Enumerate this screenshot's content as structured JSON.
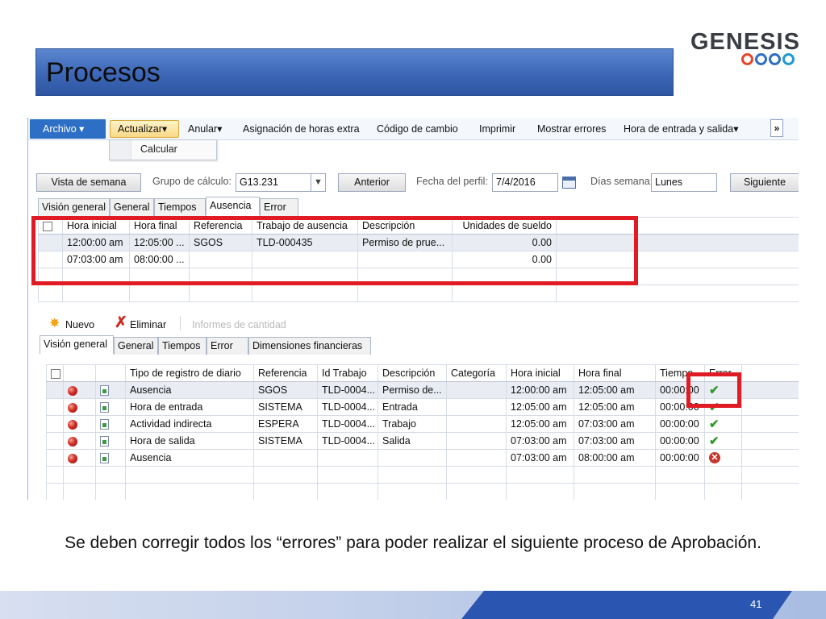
{
  "slide": {
    "title": "Procesos",
    "logo_text": "GENESIS",
    "caption": "Se deben corregir todos los “errores” para poder realizar el siguiente proceso de Aprobación.",
    "page_number": "41"
  },
  "ribbon": {
    "archivo": "Archivo ▾",
    "actualizar": "Actualizar▾",
    "anular": "Anular▾",
    "asignacion": "Asignación de horas extra",
    "codigo": "Código de cambio",
    "imprimir": "Imprimir",
    "mostrar": "Mostrar errores",
    "hora_entrada": "Hora de entrada y salida▾",
    "more": "»"
  },
  "menu": {
    "calcular": "Calcular"
  },
  "filters": {
    "vista_semana": "Vista de semana",
    "grupo_label": "Grupo de cálculo:",
    "grupo_value": "G13.231",
    "anterior": "Anterior",
    "fecha_label": "Fecha del perfil:",
    "fecha_value": "7/4/2016",
    "dias_label": "Días semana:",
    "dias_value": "Lunes",
    "siguiente": "Siguiente"
  },
  "upper_tabs": [
    "Visión general",
    "General",
    "Tiempos",
    "Ausencia",
    "Error"
  ],
  "upper_grid": {
    "headers": [
      "Hora inicial",
      "Hora final",
      "Referencia",
      "Trabajo de ausencia",
      "Descripción",
      "Unidades de sueldo"
    ],
    "rows": [
      [
        "12:00:00 am",
        "12:05:00 ...",
        "SGOS",
        "TLD-000435",
        "Permiso de prue...",
        "0.00"
      ],
      [
        "07:03:00 am",
        "08:00:00 ...",
        "",
        "",
        "",
        "0.00"
      ]
    ]
  },
  "toolbar2": {
    "nuevo": "Nuevo",
    "eliminar": "Eliminar",
    "informes": "Informes de cantidad"
  },
  "lower_tabs": [
    "Visión general",
    "General",
    "Tiempos",
    "Error",
    "Dimensiones financieras"
  ],
  "lower_grid": {
    "headers": [
      "Tipo de registro de diario",
      "Referencia",
      "Id Trabajo",
      "Descripción",
      "Categoría",
      "Hora inicial",
      "Hora final",
      "Tiempo",
      "Error"
    ],
    "rows": [
      {
        "tipo": "Ausencia",
        "ref": "SGOS",
        "id": "TLD-0004...",
        "desc": "Permiso de...",
        "cat": "",
        "ini": "12:00:00 am",
        "fin": "12:05:00 am",
        "tiempo": "00:00:00",
        "error": "ok"
      },
      {
        "tipo": "Hora de entrada",
        "ref": "SISTEMA",
        "id": "TLD-0004...",
        "desc": "Entrada",
        "cat": "",
        "ini": "12:05:00 am",
        "fin": "12:05:00 am",
        "tiempo": "00:00:00",
        "error": "ok"
      },
      {
        "tipo": "Actividad indirecta",
        "ref": "ESPERA",
        "id": "TLD-0004...",
        "desc": "Trabajo",
        "cat": "",
        "ini": "12:05:00 am",
        "fin": "07:03:00 am",
        "tiempo": "00:00:00",
        "error": "ok"
      },
      {
        "tipo": "Hora de salida",
        "ref": "SISTEMA",
        "id": "TLD-0004...",
        "desc": "Salida",
        "cat": "",
        "ini": "07:03:00 am",
        "fin": "07:03:00 am",
        "tiempo": "00:00:00",
        "error": "ok"
      },
      {
        "tipo": "Ausencia",
        "ref": "",
        "id": "",
        "desc": "",
        "cat": "",
        "ini": "07:03:00 am",
        "fin": "08:00:00 am",
        "tiempo": "00:00:00",
        "error": "error"
      }
    ]
  },
  "icons": {
    "ok_glyph": "✔",
    "error_glyph": "✕",
    "nuevo_glyph": "✸",
    "eliminar_glyph": "✗",
    "calendar": "calendar-icon",
    "status_ball": "red-status-icon",
    "record": "journal-record-icon"
  },
  "colors": {
    "title_bar": "#3d67b7",
    "highlight_red": "#e01b24",
    "archivo_blue": "#2d6fc5",
    "ok_green": "#2f9a2b"
  }
}
